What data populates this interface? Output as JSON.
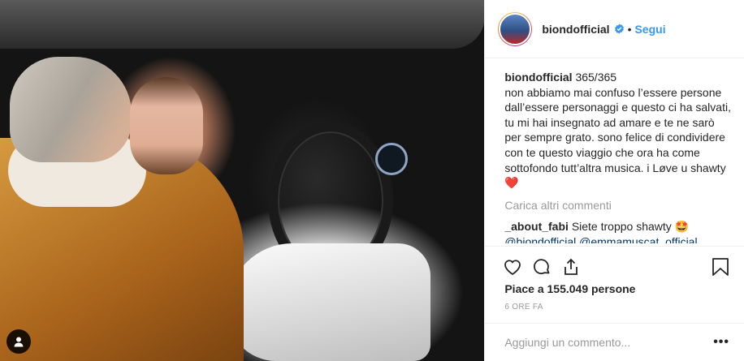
{
  "post": {
    "username": "biondofficial",
    "separator": "•",
    "follow_label": "Segui",
    "caption_user": "biondofficial",
    "caption_text": "365/365\nnon abbiamo mai confuso l’essere persone dall’essere personaggi e questo ci ha salvati, tu mi hai insegnato ad amare e te ne sarò per sempre grato. sono felice di condividere con te questo viaggio che ora ha come sottofondo tutt’altra musica. i Løve u shawty ❤️",
    "load_more_label": "Carica altri commenti",
    "comment_user": "_about_fabi",
    "comment_text": "Siete troppo shawty 🤩",
    "comment_mentions": "@biondofficial @emmamuscat_official",
    "likes_text": "Piace a 155.049 persone",
    "time_text": "6 ORE FA",
    "add_comment_placeholder": "Aggiungi un commento...",
    "more_options_label": "•••"
  },
  "colors": {
    "accent": "#3897f0",
    "mention": "#003569",
    "muted": "#999999"
  },
  "icons": [
    "verified-icon",
    "heart-icon",
    "comment-icon",
    "share-icon",
    "bookmark-icon",
    "user-tag-icon"
  ]
}
